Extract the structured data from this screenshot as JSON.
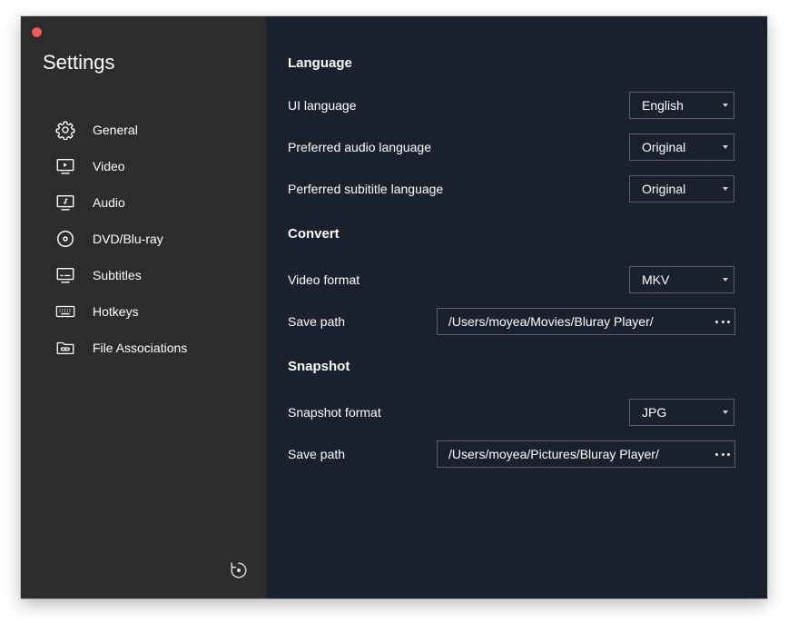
{
  "sidebar": {
    "title": "Settings",
    "items": [
      {
        "label": "General",
        "icon": "gear-icon"
      },
      {
        "label": "Video",
        "icon": "video-icon"
      },
      {
        "label": "Audio",
        "icon": "audio-icon"
      },
      {
        "label": "DVD/Blu-ray",
        "icon": "disc-icon"
      },
      {
        "label": "Subtitles",
        "icon": "subtitles-icon"
      },
      {
        "label": "Hotkeys",
        "icon": "keyboard-icon"
      },
      {
        "label": "File Associations",
        "icon": "folder-link-icon"
      }
    ],
    "reset_icon": "reset-icon"
  },
  "language": {
    "title": "Language",
    "ui_language": {
      "label": "UI language",
      "value": "English"
    },
    "audio_language": {
      "label": "Preferred audio language",
      "value": "Original"
    },
    "subtitle_language": {
      "label": "Perferred subititle language",
      "value": "Original"
    }
  },
  "convert": {
    "title": "Convert",
    "video_format": {
      "label": "Video format",
      "value": "MKV"
    },
    "save_path": {
      "label": "Save path",
      "value": "/Users/moyea/Movies/Bluray Player/"
    }
  },
  "snapshot": {
    "title": "Snapshot",
    "snapshot_format": {
      "label": "Snapshot format",
      "value": "JPG"
    },
    "save_path": {
      "label": "Save path",
      "value": "/Users/moyea/Pictures/Bluray Player/"
    }
  },
  "colors": {
    "sidebar_bg": "#2c2c2c",
    "content_bg": "#1b212c",
    "close_button": "#ff5f57",
    "field_border": "#5a5f68"
  }
}
